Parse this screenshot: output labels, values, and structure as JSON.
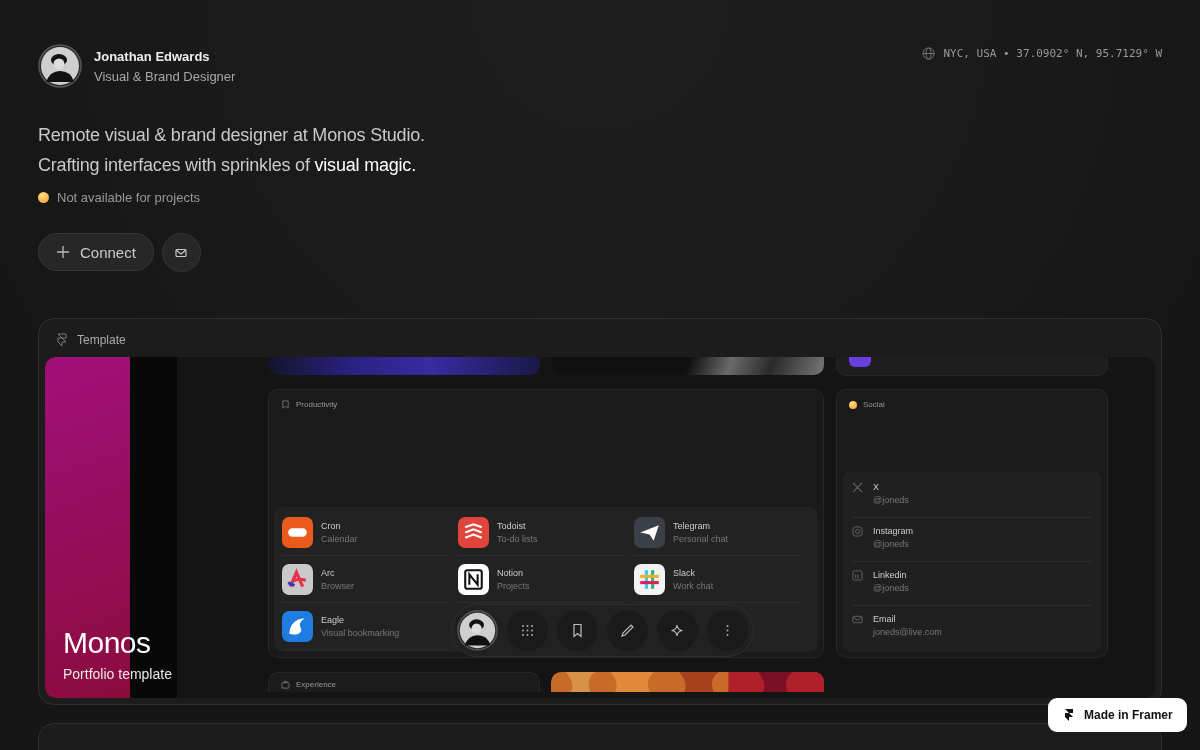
{
  "profile": {
    "name": "Jonathan Edwards",
    "role": "Visual & Brand Designer"
  },
  "location": "NYC, USA • 37.0902° N, 95.7129° W",
  "headline": [
    "Remote visual & brand designer at Monos Studio.",
    "Crafting interfaces with sprinkles of **visual magic.**"
  ],
  "status": {
    "label": "Not available for projects"
  },
  "actions": {
    "connect": "Connect"
  },
  "template": {
    "title": "Template",
    "preview": {
      "title": "Monos",
      "subtitle": "Portfolio template",
      "productivity": {
        "title": "Productivity",
        "apps": [
          {
            "name": "Cron",
            "desc": "Calendar",
            "kind": "calendar"
          },
          {
            "name": "Todoist",
            "desc": "To-do lists",
            "kind": "tasks"
          },
          {
            "name": "Telegram",
            "desc": "Personal chat",
            "kind": "messenger"
          },
          {
            "name": "Arc",
            "desc": "Browser",
            "kind": "browser"
          },
          {
            "name": "Notion",
            "desc": "Projects",
            "kind": "notes"
          },
          {
            "name": "Slack",
            "desc": "Work chat",
            "kind": "chat"
          },
          {
            "name": "Eagle",
            "desc": "Visual bookmarking",
            "kind": "bookmarks"
          }
        ]
      },
      "social": {
        "title": "Social",
        "links": [
          {
            "name": "X",
            "handle": "@joneds",
            "kind": "cross"
          },
          {
            "name": "Instagram",
            "handle": "@joneds",
            "kind": "camera"
          },
          {
            "name": "Linkedin",
            "handle": "@joneds",
            "kind": "square"
          },
          {
            "name": "Email",
            "handle": "joneds@live.com",
            "kind": "mail"
          }
        ]
      },
      "experience": "Experience"
    }
  },
  "badge": "Made in Framer"
}
